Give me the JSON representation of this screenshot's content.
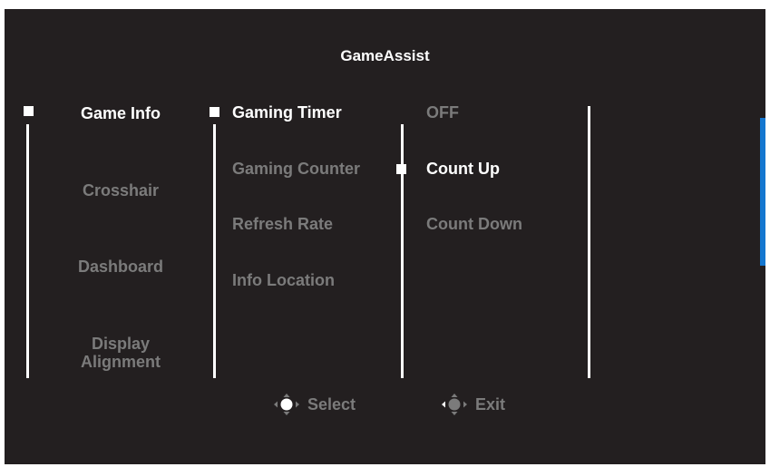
{
  "title": "GameAssist",
  "menu": {
    "level1": [
      "Game Info",
      "Crosshair",
      "Dashboard",
      "Display\nAlignment"
    ],
    "level2": [
      "Gaming Timer",
      "Gaming Counter",
      "Refresh Rate",
      "Info Location"
    ],
    "level3": [
      "OFF",
      "Count Up",
      "Count Down"
    ]
  },
  "footer": {
    "select_label": "Select",
    "exit_label": "Exit"
  },
  "colors": {
    "background": "#231f20",
    "active_text": "#ffffff",
    "inactive_text": "#7b7b7b",
    "scrollbar": "#1477d0"
  },
  "icons": {
    "select": "joystick-press-icon",
    "exit": "joystick-left-icon"
  }
}
